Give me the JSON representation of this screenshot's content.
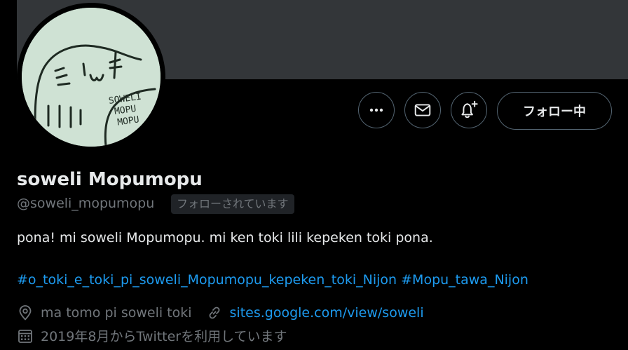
{
  "profile": {
    "display_name": "soweli Mopumopu",
    "handle": "@soweli_mopumopu",
    "follows_you_badge": "フォローされています",
    "bio": "pona! mi soweli Mopumopu. mi ken toki lili kepeken toki pona.",
    "hashtags": [
      "#o_toki_e_toki_pi_soweli_Mopumopu_kepeken_toki_Nijon",
      "#Mopu_tawa_Nijon"
    ],
    "location": "ma tomo pi soweli toki",
    "website": "sites.google.com/view/soweli",
    "joined": "2019年8月からTwitterを利用しています",
    "avatar_text": [
      "SOWELI",
      "MOPU",
      "MOPU"
    ]
  },
  "actions": {
    "more_icon": "more-horizontal-icon",
    "message_icon": "envelope-icon",
    "notify_icon": "bell-plus-icon",
    "follow_label": "フォロー中"
  },
  "colors": {
    "background": "#000000",
    "banner": "#333639",
    "accent": "#1d9bf0",
    "secondary_text": "#71767b"
  }
}
